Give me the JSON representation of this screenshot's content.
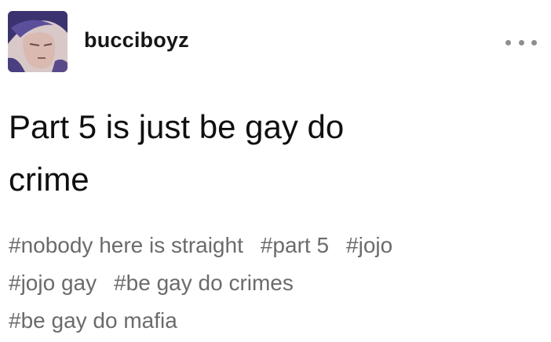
{
  "post": {
    "author": "bucciboyz",
    "avatar_icon": "avatar-image",
    "more_icon": "ellipsis-icon",
    "text_lines": [
      "Part 5 is just be gay do",
      "crime"
    ],
    "tags_rows": [
      [
        "#nobody here is straight",
        "#part 5",
        "#jojo"
      ],
      [
        "#jojo gay",
        "#be gay do crimes"
      ],
      [
        "#be gay do mafia"
      ]
    ]
  },
  "colors": {
    "text": "#0f0f0f",
    "tag_text": "#6b6b6b",
    "dots": "#8f8f8f",
    "background": "#ffffff"
  }
}
